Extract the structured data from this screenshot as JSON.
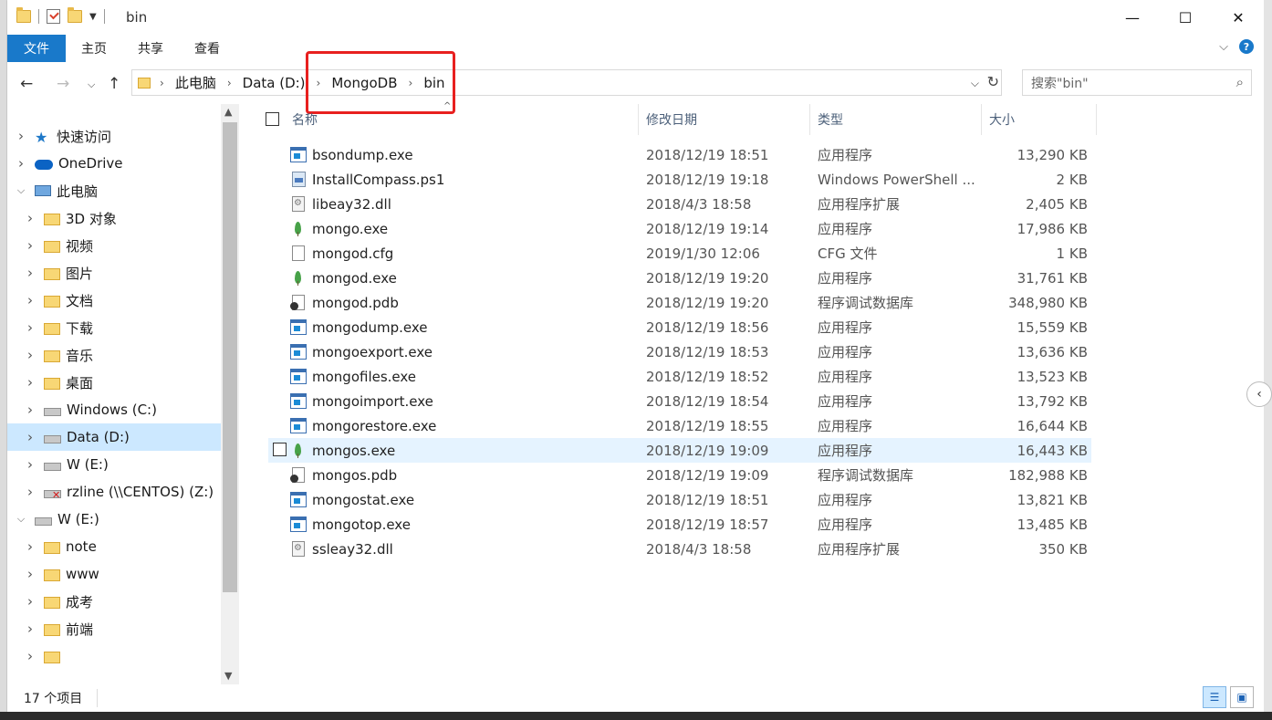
{
  "window": {
    "title": "bin",
    "controls": {
      "minimize": "—",
      "maximize": "☐",
      "close": "✕"
    }
  },
  "ribbon": {
    "tabs": [
      "文件",
      "主页",
      "共享",
      "查看"
    ]
  },
  "address": {
    "crumbs": [
      "此电脑",
      "Data (D:)",
      "MongoDB",
      "bin"
    ],
    "search_placeholder": "搜索\"bin\""
  },
  "navpane": {
    "items": [
      {
        "label": "快速访问",
        "icon": "star-icon",
        "indent": 0,
        "expanded": false
      },
      {
        "label": "OneDrive",
        "icon": "cloud-icon",
        "indent": 0,
        "expanded": false
      },
      {
        "label": "此电脑",
        "icon": "pc-icon",
        "indent": 0,
        "expanded": true
      },
      {
        "label": "3D 对象",
        "icon": "folder-icon",
        "indent": 1
      },
      {
        "label": "视频",
        "icon": "folder-icon",
        "indent": 1
      },
      {
        "label": "图片",
        "icon": "folder-icon",
        "indent": 1
      },
      {
        "label": "文档",
        "icon": "folder-icon",
        "indent": 1
      },
      {
        "label": "下载",
        "icon": "folder-icon",
        "indent": 1
      },
      {
        "label": "音乐",
        "icon": "folder-icon",
        "indent": 1
      },
      {
        "label": "桌面",
        "icon": "folder-icon",
        "indent": 1
      },
      {
        "label": "Windows (C:)",
        "icon": "drive-icon",
        "indent": 1
      },
      {
        "label": "Data (D:)",
        "icon": "drive-icon",
        "indent": 1,
        "selected": true
      },
      {
        "label": "W (E:)",
        "icon": "drive-icon",
        "indent": 1
      },
      {
        "label": "rzline (\\\\CENTOS) (Z:)",
        "icon": "network-drive-icon",
        "indent": 1
      },
      {
        "label": "W (E:)",
        "icon": "drive-icon",
        "indent": 0,
        "expanded": true
      },
      {
        "label": "note",
        "icon": "folder-icon",
        "indent": 1
      },
      {
        "label": "www",
        "icon": "folder-icon",
        "indent": 1
      },
      {
        "label": "成考",
        "icon": "folder-icon",
        "indent": 1
      },
      {
        "label": "前端",
        "icon": "folder-icon",
        "indent": 1
      },
      {
        "label": "",
        "icon": "folder-icon",
        "indent": 1
      }
    ]
  },
  "filelist": {
    "columns": {
      "name": "名称",
      "date": "修改日期",
      "type": "类型",
      "size": "大小"
    },
    "files": [
      {
        "name": "bsondump.exe",
        "date": "2018/12/19 18:51",
        "type": "应用程序",
        "size": "13,290 KB",
        "icon": "exe"
      },
      {
        "name": "InstallCompass.ps1",
        "date": "2018/12/19 19:18",
        "type": "Windows PowerShell ...",
        "size": "2 KB",
        "icon": "ps"
      },
      {
        "name": "libeay32.dll",
        "date": "2018/4/3 18:58",
        "type": "应用程序扩展",
        "size": "2,405 KB",
        "icon": "dll"
      },
      {
        "name": "mongo.exe",
        "date": "2018/12/19 19:14",
        "type": "应用程序",
        "size": "17,986 KB",
        "icon": "leaf"
      },
      {
        "name": "mongod.cfg",
        "date": "2019/1/30 12:06",
        "type": "CFG 文件",
        "size": "1 KB",
        "icon": "doc"
      },
      {
        "name": "mongod.exe",
        "date": "2018/12/19 19:20",
        "type": "应用程序",
        "size": "31,761 KB",
        "icon": "leaf"
      },
      {
        "name": "mongod.pdb",
        "date": "2018/12/19 19:20",
        "type": "程序调试数据库",
        "size": "348,980 KB",
        "icon": "pdb"
      },
      {
        "name": "mongodump.exe",
        "date": "2018/12/19 18:56",
        "type": "应用程序",
        "size": "15,559 KB",
        "icon": "exe"
      },
      {
        "name": "mongoexport.exe",
        "date": "2018/12/19 18:53",
        "type": "应用程序",
        "size": "13,636 KB",
        "icon": "exe"
      },
      {
        "name": "mongofiles.exe",
        "date": "2018/12/19 18:52",
        "type": "应用程序",
        "size": "13,523 KB",
        "icon": "exe"
      },
      {
        "name": "mongoimport.exe",
        "date": "2018/12/19 18:54",
        "type": "应用程序",
        "size": "13,792 KB",
        "icon": "exe"
      },
      {
        "name": "mongorestore.exe",
        "date": "2018/12/19 18:55",
        "type": "应用程序",
        "size": "16,644 KB",
        "icon": "exe"
      },
      {
        "name": "mongos.exe",
        "date": "2018/12/19 19:09",
        "type": "应用程序",
        "size": "16,443 KB",
        "icon": "leaf",
        "hover": true
      },
      {
        "name": "mongos.pdb",
        "date": "2018/12/19 19:09",
        "type": "程序调试数据库",
        "size": "182,988 KB",
        "icon": "pdb"
      },
      {
        "name": "mongostat.exe",
        "date": "2018/12/19 18:51",
        "type": "应用程序",
        "size": "13,821 KB",
        "icon": "exe"
      },
      {
        "name": "mongotop.exe",
        "date": "2018/12/19 18:57",
        "type": "应用程序",
        "size": "13,485 KB",
        "icon": "exe"
      },
      {
        "name": "ssleay32.dll",
        "date": "2018/4/3 18:58",
        "type": "应用程序扩展",
        "size": "350 KB",
        "icon": "dll"
      }
    ]
  },
  "statusbar": {
    "count": "17 个项目"
  },
  "colors": {
    "accent": "#1979ca",
    "highlight_box": "#e8201f",
    "selection": "#cce8ff",
    "hover": "#e5f3ff"
  }
}
